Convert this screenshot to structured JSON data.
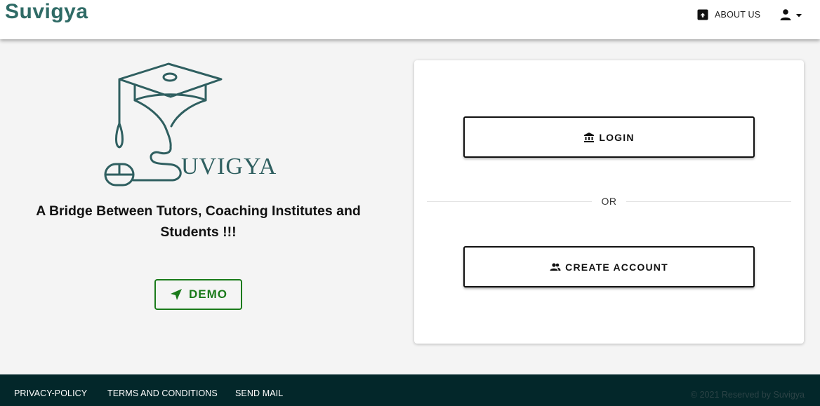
{
  "header": {
    "brand": "Suvigya",
    "about_label": "ABOUT US",
    "icons": {
      "about": "info-box-icon",
      "user": "account-icon",
      "menu": "caret-down-icon"
    }
  },
  "hero": {
    "logo_text": "UVIGYA",
    "tagline_line1": "A Bridge Between Tutors, Coaching Institutes and",
    "tagline_line2": "Students !!!",
    "demo_label": "DEMO",
    "demo_icon": "navigation-arrow-icon"
  },
  "auth_card": {
    "login_label": "LOGIN",
    "login_icon": "institution-icon",
    "or_label": "OR",
    "create_label": "CREATE ACCOUNT",
    "create_icon": "people-icon"
  },
  "footer": {
    "links": [
      "PRIVACY-POLICY",
      "TERMS AND CONDITIONS",
      "SEND MAIL"
    ],
    "copyright": "© 2021 Reserved by Suvigya"
  },
  "colors": {
    "brand": "#2f6b66",
    "demo_green": "#1a7a1a",
    "footer_bg": "#03272a",
    "page_bg": "#f4f4f4"
  }
}
